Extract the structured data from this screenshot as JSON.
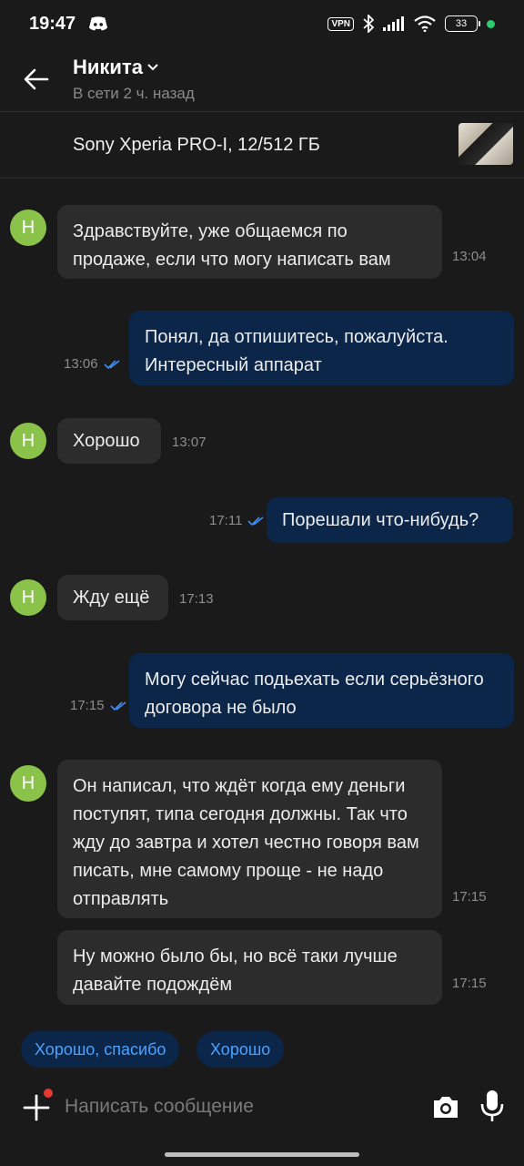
{
  "status_bar": {
    "time": "19:47",
    "vpn_label": "VPN",
    "battery": "33"
  },
  "header": {
    "contact_name": "Никита",
    "last_seen": "В сети 2 ч. назад"
  },
  "product": {
    "title": "Sony Xperia PRO-I, 12/512 ГБ"
  },
  "contact_initial": "Н",
  "messages": [
    {
      "direction": "in",
      "text": "Здравствуйте, уже общаемся по продаже, если что могу написать вам",
      "time": "13:04"
    },
    {
      "direction": "out",
      "text": "Понял, да отпишитесь, пожалуйста. Интересный аппарат",
      "time": "13:06",
      "read": true
    },
    {
      "direction": "in",
      "text": "Хорошо",
      "time": "13:07"
    },
    {
      "direction": "out",
      "text": "Порешали что-нибудь?",
      "time": "17:11",
      "read": true
    },
    {
      "direction": "in",
      "text": "Жду ещё",
      "time": "17:13"
    },
    {
      "direction": "out",
      "text": "Могу сейчас подьехать если серьёзного договора не было",
      "time": "17:15",
      "read": true
    },
    {
      "direction": "in",
      "text": "Он написал, что ждёт когда ему деньги поступят, типа сегодня должны. Так что жду до завтра и хотел честно говоря вам писать, мне самому проще - не надо отправлять",
      "time": "17:15"
    },
    {
      "direction": "in",
      "text": "Ну можно было бы, но всё таки лучше давайте подождём",
      "time": "17:15"
    }
  ],
  "quick_replies": [
    "Хорошо, спасибо",
    "Хорошо"
  ],
  "composer": {
    "placeholder": "Написать сообщение"
  },
  "colors": {
    "incoming_bubble": "#2c2c2c",
    "outgoing_bubble": "#0b2648",
    "accent": "#4aa3ff",
    "avatar": "#8bc34a"
  }
}
